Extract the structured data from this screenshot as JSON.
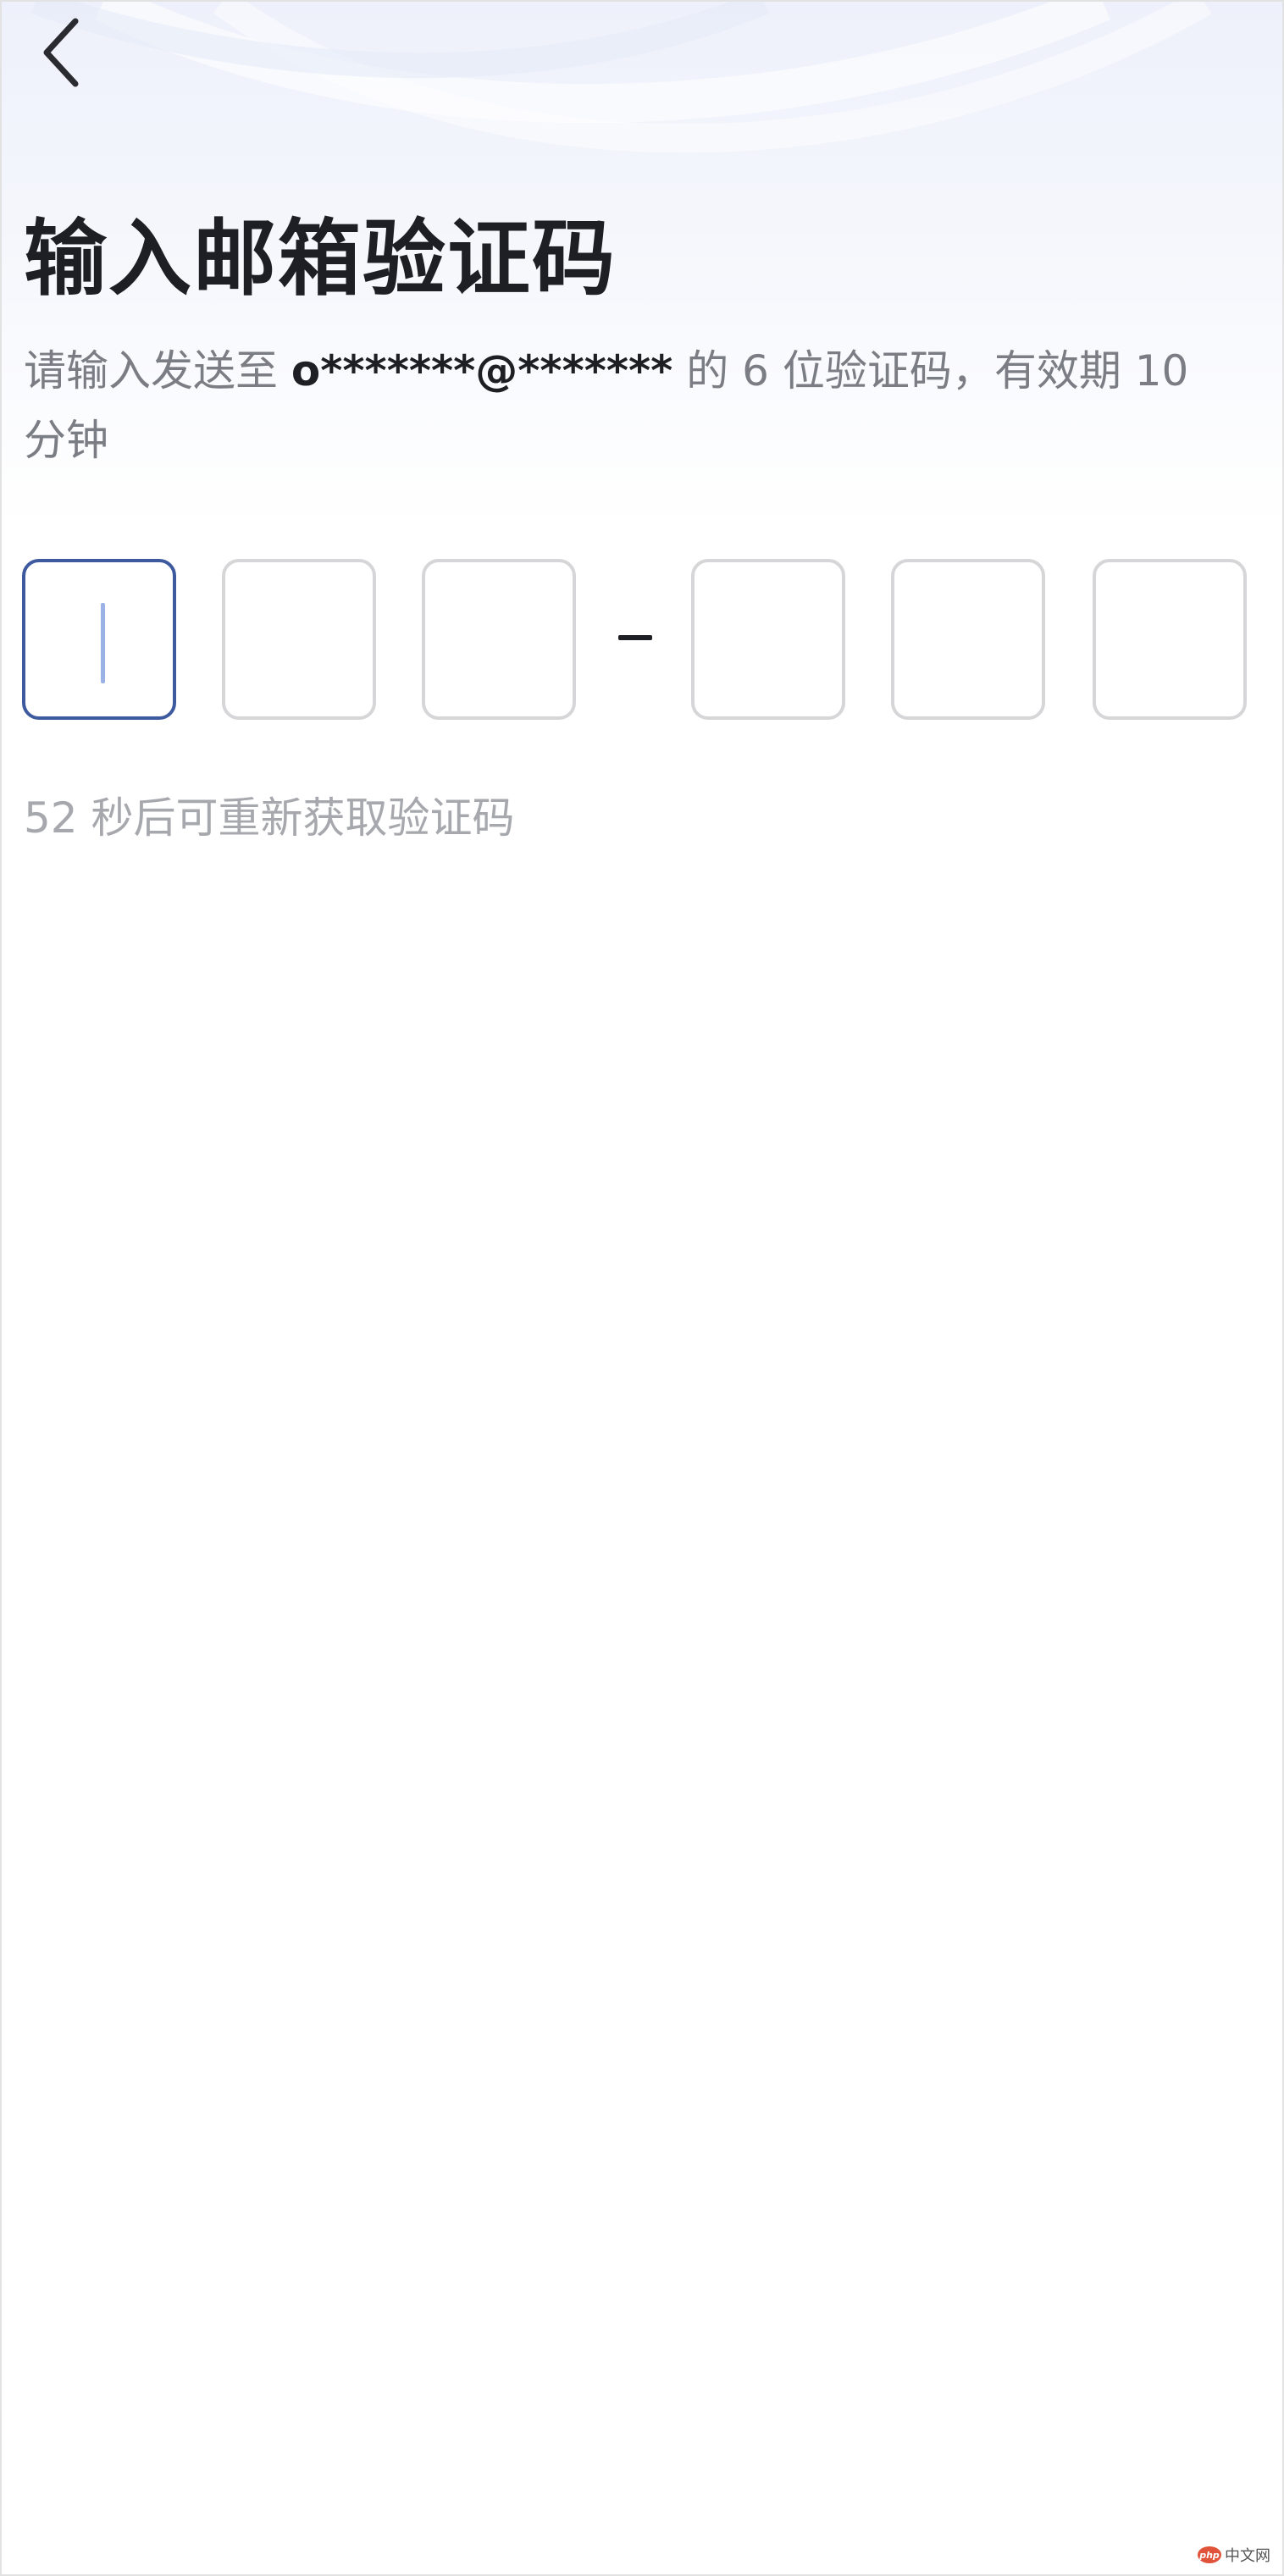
{
  "header": {
    "back_icon": "chevron-left-icon"
  },
  "main": {
    "title": "输入邮箱验证码",
    "subtitle_prefix": "请输入发送至 ",
    "masked_email": "o*******@*******",
    "subtitle_suffix": " 的 6 位验证码，有效期 10 分钟",
    "code_separator": "–",
    "code_digits": [
      "",
      "",
      "",
      "",
      "",
      ""
    ],
    "countdown_text": "52 秒后可重新获取验证码"
  },
  "watermark": {
    "logo_text": "php",
    "text": "中文网"
  },
  "colors": {
    "active_border": "#3d5a9e",
    "inactive_border": "#d6d6d8",
    "caret": "#9bb2e6",
    "title": "#1e1f24",
    "muted_text": "#7b7d84",
    "countdown_text": "#a6a8ad"
  }
}
